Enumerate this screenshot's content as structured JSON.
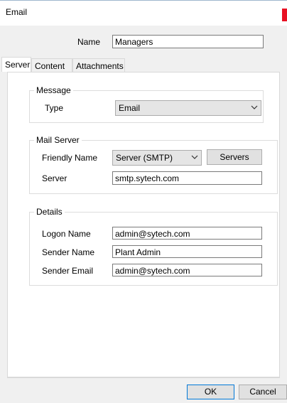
{
  "window": {
    "title": "Email"
  },
  "name_field": {
    "label": "Name",
    "value": "Managers"
  },
  "tabs": [
    {
      "label": "Server",
      "active": true
    },
    {
      "label": "Content",
      "active": false
    },
    {
      "label": "Attachments",
      "active": false
    }
  ],
  "message_group": {
    "legend": "Message",
    "type_label": "Type",
    "type_value": "Email"
  },
  "mail_server_group": {
    "legend": "Mail Server",
    "friendly_name_label": "Friendly Name",
    "friendly_name_value": "Server (SMTP)",
    "servers_button": "Servers",
    "server_label": "Server",
    "server_value": "smtp.sytech.com"
  },
  "details_group": {
    "legend": "Details",
    "logon_name_label": "Logon Name",
    "logon_name_value": "admin@sytech.com",
    "sender_name_label": "Sender Name",
    "sender_name_value": "Plant Admin",
    "sender_email_label": "Sender Email",
    "sender_email_value": "admin@sytech.com"
  },
  "footer": {
    "ok_label": "OK",
    "cancel_label": "Cancel"
  },
  "colors": {
    "close_button": "#e81123",
    "window_bg": "#f0f0f0",
    "panel_bg": "#ffffff"
  },
  "icons": [
    "chevron-down-icon",
    "close-icon"
  ]
}
